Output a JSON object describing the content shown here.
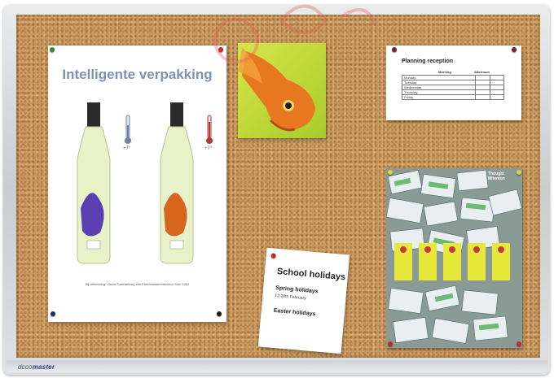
{
  "board": {
    "brand_prefix": "dcco",
    "brand_suffix": "master",
    "colors": {
      "cork": "#c99a5f",
      "frame": "#d4d7db"
    }
  },
  "poster": {
    "title": "Intelligente verpakking",
    "thermo_left_label": "+7°",
    "thermo_right_label": "+7°",
    "caption": "Bij-afbeelding: Vinciu/Tweetakking van Ehrenvassentrauvtion-Sien 1992"
  },
  "planning": {
    "title": "Planning reception",
    "col_morning": "Morning",
    "col_afternoon": "Afternoon",
    "days": [
      "Monday",
      "Tuesday",
      "Wednesday",
      "Thursday",
      "Friday"
    ]
  },
  "school": {
    "title": "School holidays",
    "spring": "Spring holidays",
    "spring_date": "12-20th February",
    "easter": "Easter holidays"
  },
  "collage": {
    "header_text": "Thought Mitenton"
  },
  "icons": [
    "pushpin-icon",
    "goldfish-icon",
    "bottle-icon",
    "thermometer-icon"
  ]
}
